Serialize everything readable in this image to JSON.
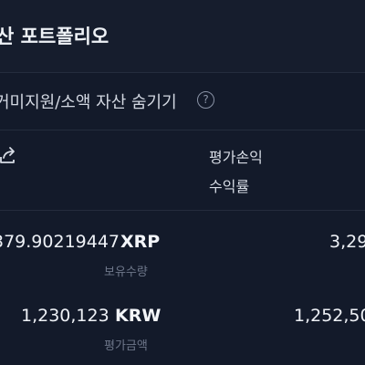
{
  "header": {
    "title": "산 포트폴리오"
  },
  "filter": {
    "hide_label": "거미지원/소액 자산 숨기기",
    "help_glyph": "?"
  },
  "columns": {
    "profit_label": "평가손익",
    "return_label": "수익률"
  },
  "holding": {
    "quantity": "379.90219447",
    "quantity_unit": "XRP",
    "quantity_caption": "보유수량",
    "profit_value": "3,29",
    "eval_amount": "1,230,123",
    "eval_unit": "KRW",
    "eval_caption": "평가금액",
    "eval_right": "1,252,50"
  },
  "colors": {
    "background": "#131a2a",
    "header": "#161d2d",
    "divider": "#242c3d",
    "muted": "#6e778a"
  },
  "icons": {
    "share": "share-icon",
    "help": "help-circle-icon"
  }
}
